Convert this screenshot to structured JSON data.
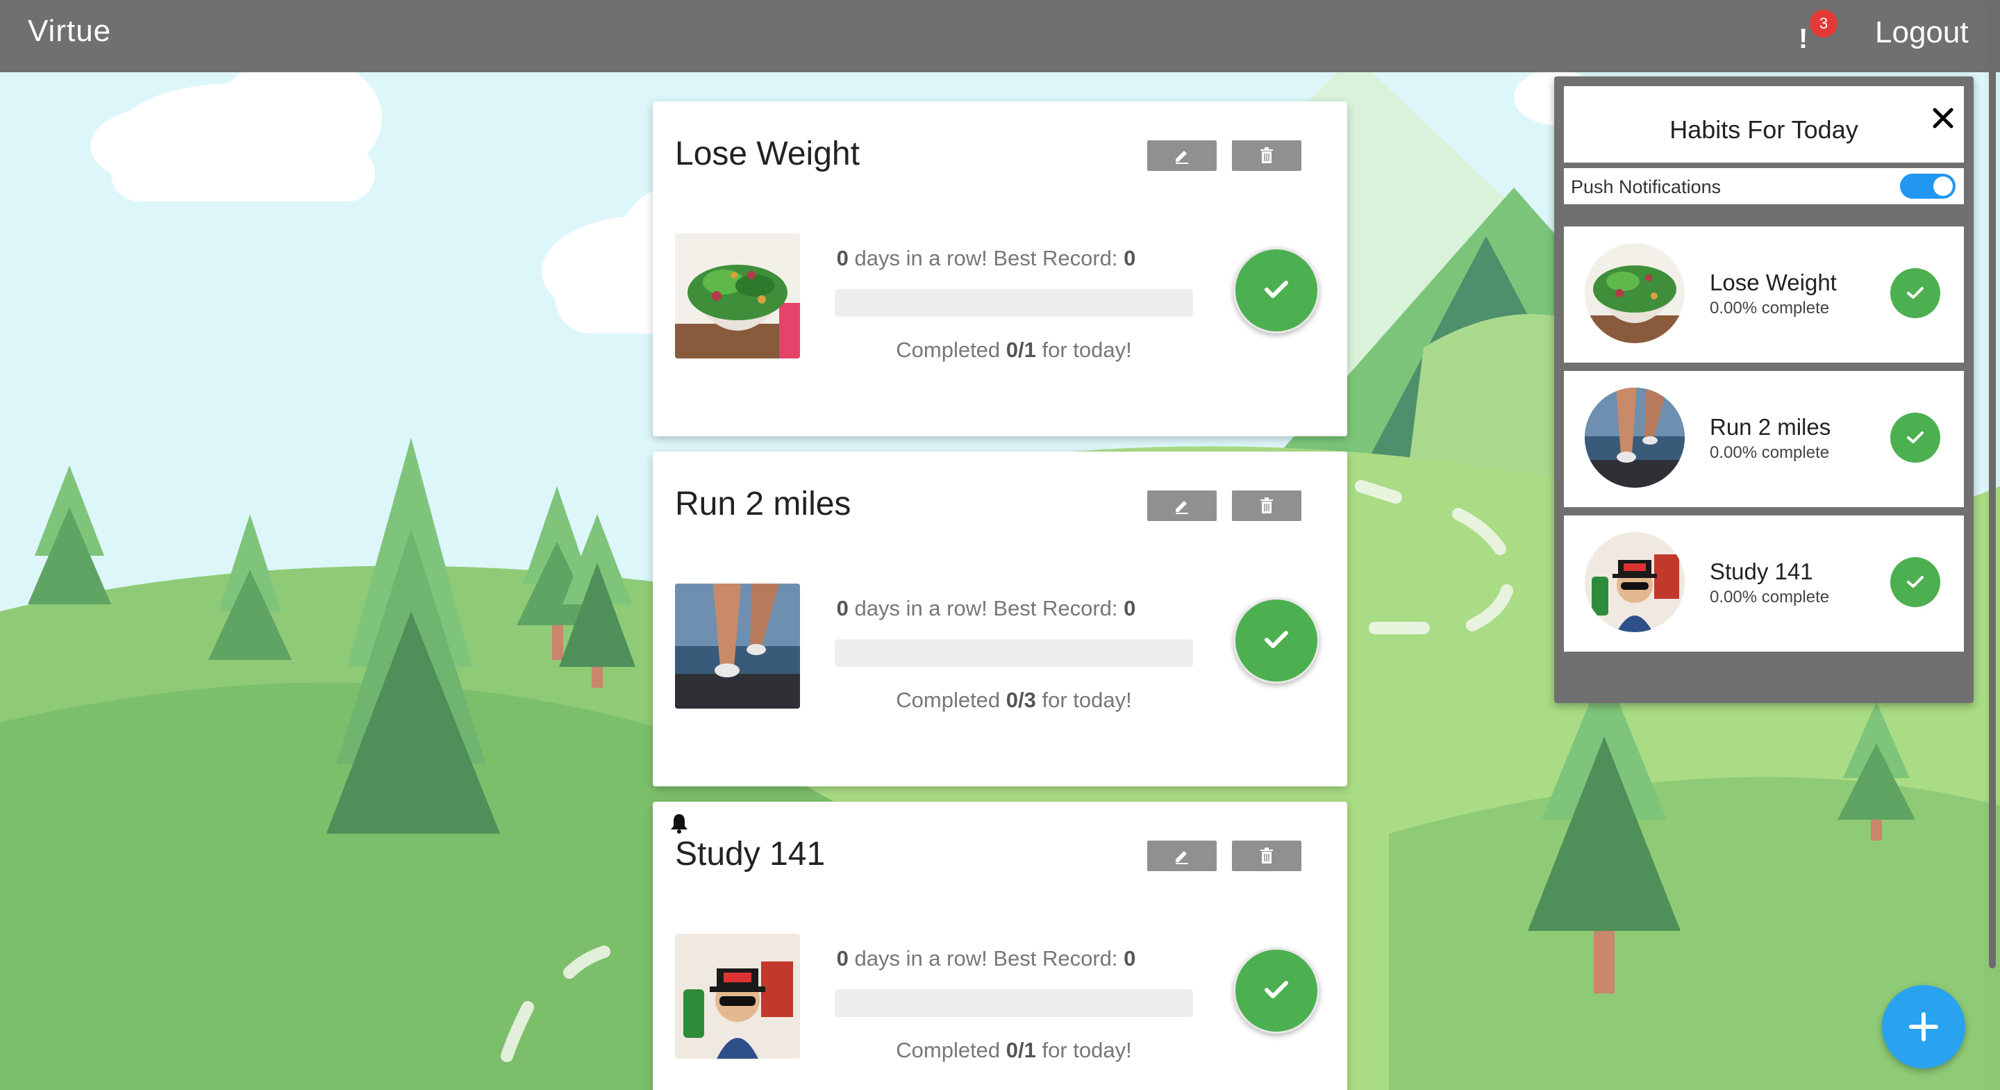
{
  "app": {
    "title": "Virtue"
  },
  "topbar": {
    "notification_count": "3",
    "notification_symbol": "!",
    "logout_label": "Logout"
  },
  "habits": [
    {
      "title": "Lose Weight",
      "streak_count": "0",
      "streak_text": " days in a row! Best Record: ",
      "best_record": "0",
      "completed_prefix": "Completed ",
      "completed_value": "0/1",
      "completed_suffix": " for today!",
      "progress": 0,
      "image": "salad-image",
      "has_reminder": false
    },
    {
      "title": "Run 2 miles",
      "streak_count": "0",
      "streak_text": " days in a row! Best Record: ",
      "best_record": "0",
      "completed_prefix": "Completed ",
      "completed_value": "0/3",
      "completed_suffix": " for today!",
      "progress": 0,
      "image": "runner-legs-image",
      "has_reminder": false
    },
    {
      "title": "Study 141",
      "streak_count": "0",
      "streak_text": " days in a row! Best Record: ",
      "best_record": "0",
      "completed_prefix": "Completed ",
      "completed_value": "0/1",
      "completed_suffix": " for today!",
      "progress": 0,
      "image": "person-with-sunglasses-image",
      "has_reminder": true
    }
  ],
  "panel": {
    "title": "Habits For Today",
    "push_label": "Push Notifications",
    "push_enabled": true,
    "items": [
      {
        "name": "Lose Weight",
        "percent": "0.00% complete"
      },
      {
        "name": "Run 2 miles",
        "percent": "0.00% complete"
      },
      {
        "name": "Study 141",
        "percent": "0.00% complete"
      }
    ]
  },
  "colors": {
    "topbar": "#707070",
    "success": "#4caf50",
    "accent": "#2196f3",
    "fab": "#29a3f0",
    "badge": "#e53935"
  },
  "icons": [
    "notification-icon",
    "edit-pencil-icon",
    "trash-icon",
    "check-icon",
    "bell-icon",
    "close-icon",
    "plus-icon"
  ]
}
